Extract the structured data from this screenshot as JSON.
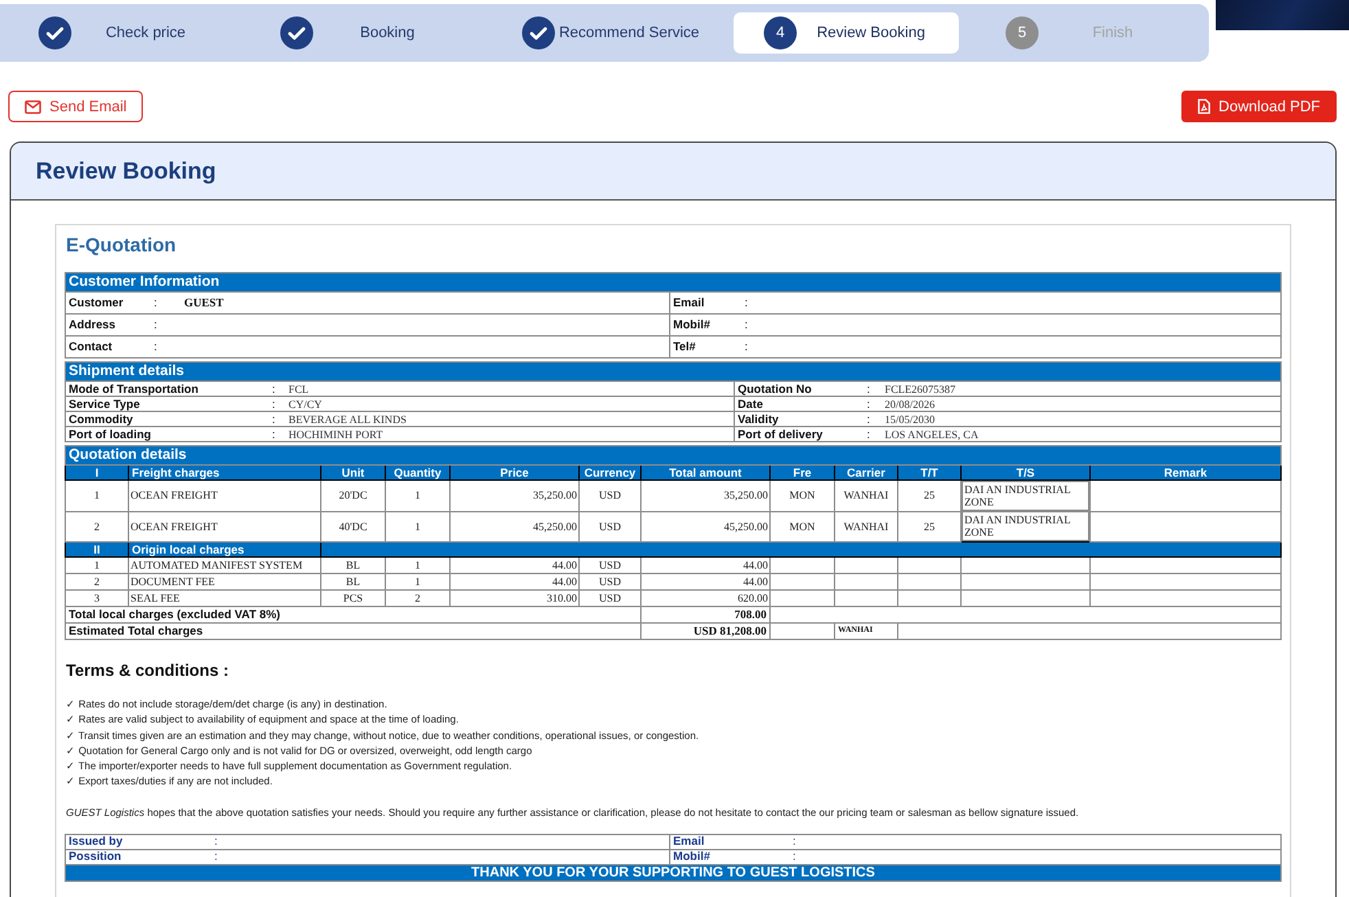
{
  "stepper": {
    "steps": [
      {
        "label": "Check price",
        "completed": true,
        "selected": false
      },
      {
        "label": "Booking",
        "completed": true,
        "selected": false
      },
      {
        "label": "Recommend Service",
        "completed": true,
        "selected": false
      },
      {
        "label": "Review Booking",
        "completed": false,
        "selected": true,
        "number": "4"
      },
      {
        "label": "Finish",
        "completed": false,
        "selected": false,
        "number": "5"
      }
    ]
  },
  "actions": [
    {
      "label": "Send Email",
      "kind": "outline"
    },
    {
      "label": "Download PDF",
      "kind": "primary"
    }
  ],
  "card": {
    "title": "Review Booking"
  },
  "quotation": {
    "title": "E-Quotation",
    "customer_information": {
      "heading": "Customer Information",
      "rows": [
        {
          "left": {
            "label": "Customer",
            "separator": ":",
            "value": "GUEST"
          },
          "right": {
            "label": "Email",
            "separator": ":"
          }
        },
        {
          "left": {
            "label": "Address",
            "separator": ":"
          },
          "right": {
            "label": "Mobil#",
            "separator": ":"
          }
        },
        {
          "left": {
            "label": "Contact",
            "separator": ":"
          },
          "right": {
            "label": "Tel#",
            "separator": ":"
          }
        }
      ]
    },
    "shipment_details": {
      "heading": "Shipment details",
      "rows": [
        {
          "left": {
            "label": "Mode of Transportation",
            "separator": ":",
            "value": "FCL"
          },
          "right": {
            "label": "Quotation No",
            "separator": ":",
            "value": "FCLE26075387"
          }
        },
        {
          "left": {
            "label": "Service Type",
            "separator": ":",
            "value": "CY/CY"
          },
          "right": {
            "label": "Date",
            "separator": ":",
            "value": "20/08/2026"
          }
        },
        {
          "left": {
            "label": "Commodity",
            "separator": ":",
            "value": "BEVERAGE ALL KINDS"
          },
          "right": {
            "label": "Validity",
            "separator": ":",
            "value": "15/05/2030"
          }
        },
        {
          "left": {
            "label": "Port of loading",
            "separator": ":",
            "value": "HOCHIMINH PORT"
          },
          "right": {
            "label": "Port of delivery",
            "separator": ":",
            "value": "LOS ANGELES, CA"
          }
        }
      ]
    },
    "quotation_details": {
      "heading": "Quotation details",
      "columns": [
        "Unit",
        "Quantity",
        "Price",
        "Currency",
        "Total amount",
        "Fre",
        "Carrier",
        "T/T",
        "T/S",
        "Remark"
      ],
      "sections": [
        {
          "number": "I",
          "title": "Freight charges",
          "rows": [
            {
              "no": "1",
              "description": "OCEAN FREIGHT",
              "unit": "20'DC",
              "quantity": "1",
              "price": "35,250.00",
              "currency": "USD",
              "total_amount": "35,250.00",
              "fre": "MON",
              "carrier": "WANHAI",
              "tt": "25",
              "ts": "DAI AN INDUSTRIAL ZONE"
            },
            {
              "no": "2",
              "description": "OCEAN FREIGHT",
              "unit": "40'DC",
              "quantity": "1",
              "price": "45,250.00",
              "currency": "USD",
              "total_amount": "45,250.00",
              "fre": "MON",
              "carrier": "WANHAI",
              "tt": "25",
              "ts": "DAI AN INDUSTRIAL ZONE"
            }
          ]
        },
        {
          "number": "II",
          "title": "Origin local charges",
          "rows": [
            {
              "no": "1",
              "description": "AUTOMATED MANIFEST SYSTEM",
              "unit": "BL",
              "quantity": "1",
              "price": "44.00",
              "currency": "USD",
              "total_amount": "44.00"
            },
            {
              "no": "2",
              "description": "DOCUMENT FEE",
              "unit": "BL",
              "quantity": "1",
              "price": "44.00",
              "currency": "USD",
              "total_amount": "44.00"
            },
            {
              "no": "3",
              "description": "SEAL FEE",
              "unit": "PCS",
              "quantity": "2",
              "price": "310.00",
              "currency": "USD",
              "total_amount": "620.00"
            }
          ]
        }
      ],
      "totals": [
        {
          "label": "Total local charges (excluded VAT 8%)",
          "amount": "708.00"
        },
        {
          "label": "Estimated Total charges",
          "amount": "USD 81,208.00",
          "carrier": "WANHAI"
        }
      ]
    },
    "terms": {
      "title": "Terms & conditions :",
      "items": [
        "✓ Rates do not include storage/dem/det charge (is any) in destination.",
        "✓ Rates are valid subject to availability of equipment and space at the time of loading.",
        "✓ Transit times given are an estimation and they may change, without notice, due to weather conditions, operational issues, or congestion.",
        "✓ Quotation for General Cargo only and is not valid for DG or oversized, overweight, odd length cargo",
        "✓ The importer/exporter needs to have full supplement documentation as Government regulation.",
        "✓ Export taxes/duties if any are not included."
      ],
      "closing": "*GUEST Logistics* hopes that the above quotation satisfies your needs. Should you require any further assistance or clarification, please do not hesitate to contact the our pricing team or salesman as bellow signature issued."
    },
    "signature": {
      "rows": [
        {
          "left": {
            "label": "Issued by",
            "separator": ":"
          },
          "right": {
            "label": "Email",
            "separator": ":"
          }
        },
        {
          "left": {
            "label": "Possition",
            "separator": ":"
          },
          "right": {
            "label": "Mobil#",
            "separator": ":"
          }
        }
      ],
      "thanks": "THANK YOU FOR YOUR SUPPORTING TO GUEST LOGISTICS"
    }
  }
}
